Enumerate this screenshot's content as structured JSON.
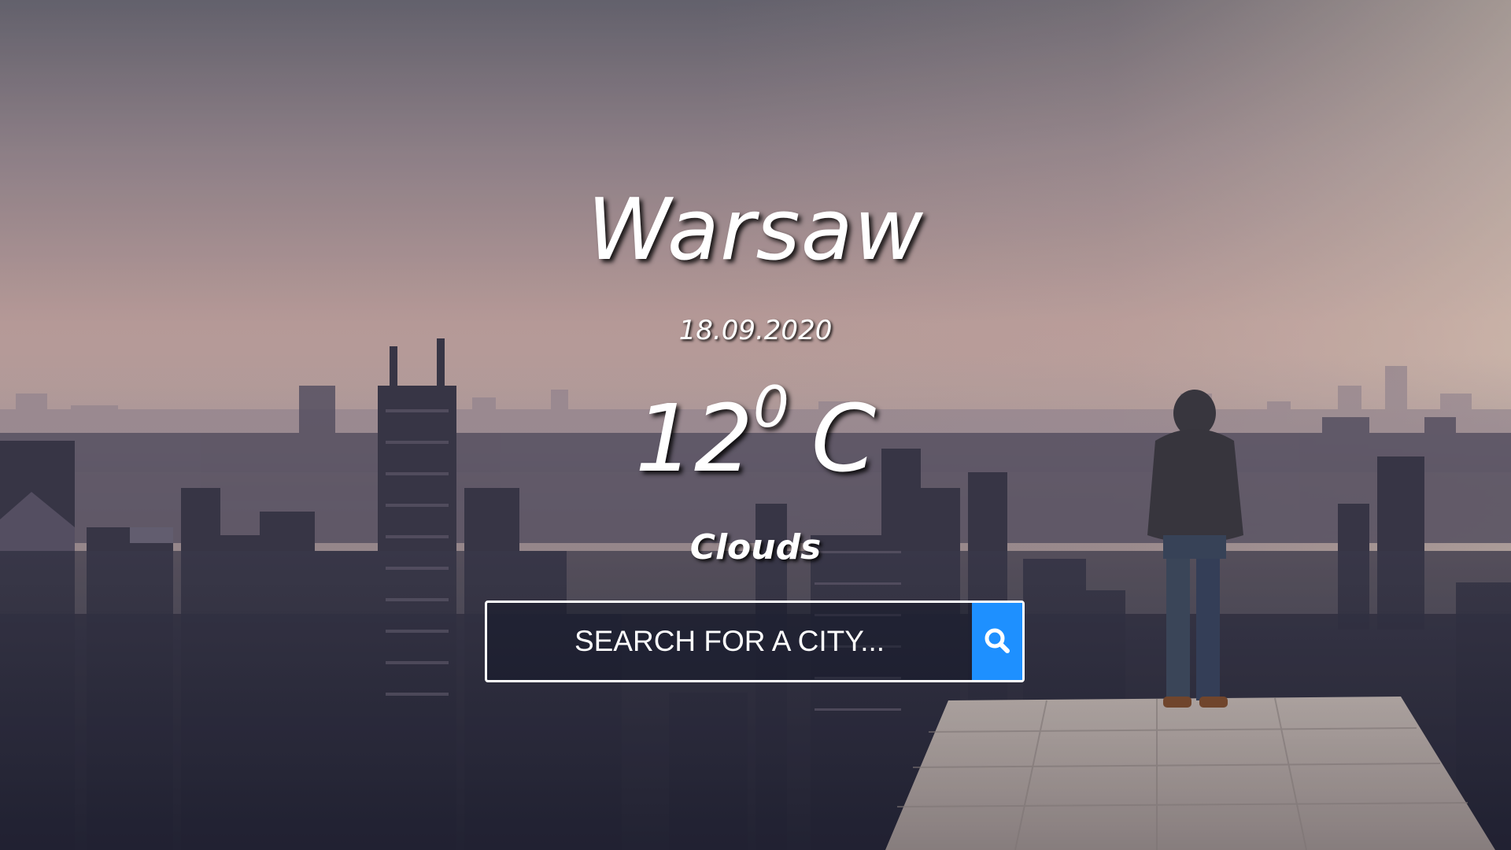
{
  "weather": {
    "city": "Warsaw",
    "date": "18.09.2020",
    "temp_value": "12",
    "temp_degree": "0",
    "temp_unit": "C",
    "description": "Clouds"
  },
  "search": {
    "placeholder": "SEARCH FOR A CITY...",
    "value": "",
    "button_icon": "search-icon",
    "button_color": "#1e90ff"
  },
  "background": {
    "scene": "city-skyline-icon",
    "sky_color": "#c9a6a0"
  }
}
